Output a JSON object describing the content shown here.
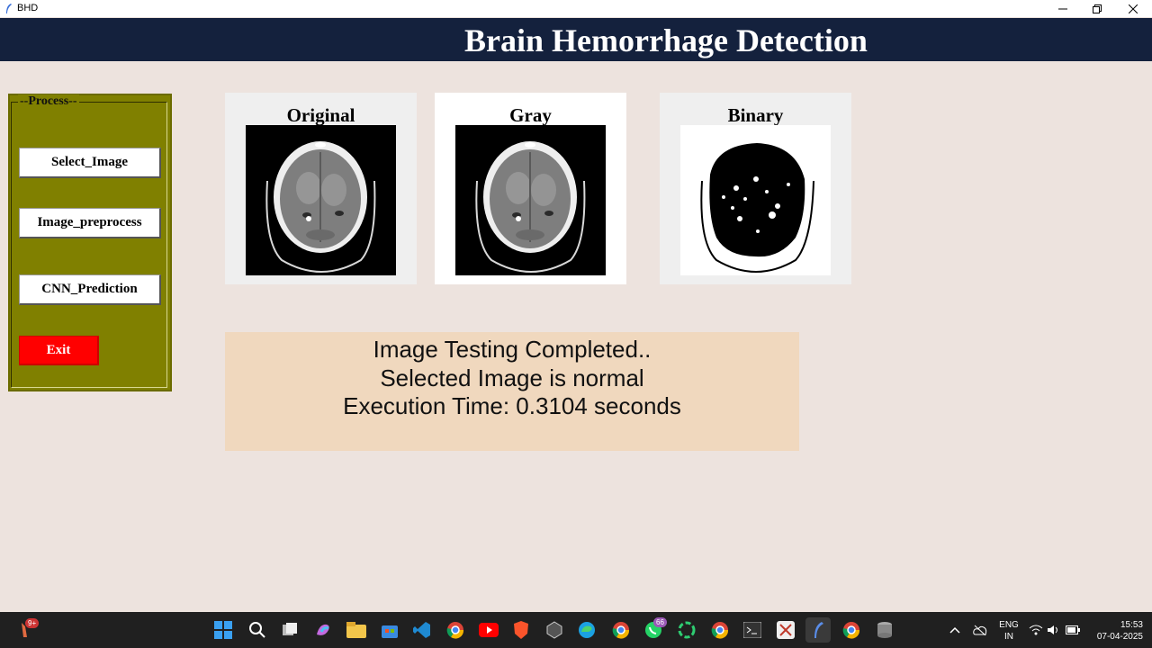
{
  "window": {
    "title": "BHD"
  },
  "header": {
    "title": "Brain Hemorrhage Detection"
  },
  "process": {
    "label": "--Process--",
    "buttons": {
      "select": "Select_Image",
      "preprocess": "Image_preprocess",
      "predict": "CNN_Prediction",
      "exit": "Exit"
    }
  },
  "panels": {
    "original": "Original",
    "gray": "Gray",
    "binary": "Binary"
  },
  "result": {
    "line1": "Image Testing Completed..",
    "line2": "Selected Image is normal",
    "line3": "Execution Time: 0.3104 seconds"
  },
  "taskbar": {
    "notify_badge": "9+",
    "whatsapp_badge": "66",
    "lang": "ENG",
    "region": "IN",
    "time": "15:53",
    "date": "07-04-2025"
  },
  "colors": {
    "header_bg": "#14213d",
    "process_bg": "#808000",
    "exit_bg": "#ff0000",
    "result_bg": "#f0d8be",
    "app_bg": "#ede3de"
  }
}
